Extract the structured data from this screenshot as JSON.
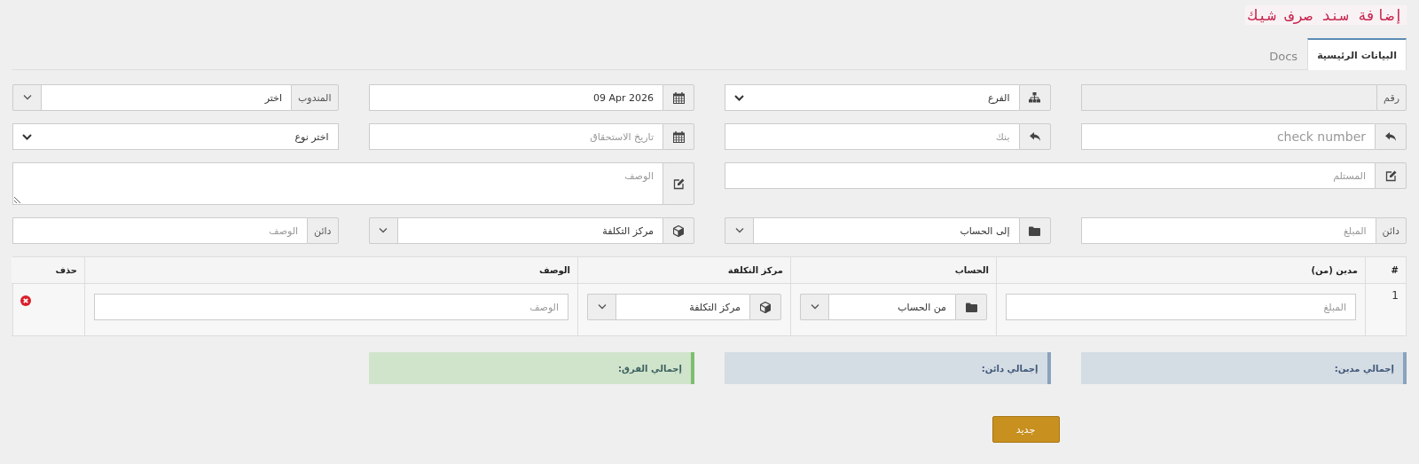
{
  "title": "إضافة سند صرف شيك",
  "tabs": [
    {
      "label": "البيانات الرئيسية",
      "selected": true
    },
    {
      "label": "Docs",
      "selected": false
    }
  ],
  "fields": [
    {
      "kind": "number",
      "label": "رقم",
      "disabled": true
    },
    {
      "kind": "branch",
      "value": "الفرع",
      "disabled": false
    },
    {
      "kind": "date",
      "value": "09 Apr 2026",
      "disabled": false
    },
    {
      "kind": "rep",
      "label": "المندوب",
      "value": "اختر",
      "disabled": false
    },
    {
      "kind": "check",
      "placeholder": "check number",
      "disabled": false
    },
    {
      "kind": "bank",
      "placeholder": "بنك",
      "disabled": false
    },
    {
      "kind": "due_date",
      "placeholder": "تاريخ الاستحقاق",
      "disabled": false
    },
    {
      "kind": "type",
      "value": "اختر نوع",
      "disabled": false
    },
    {
      "kind": "payee",
      "placeholder": "المستلم",
      "disabled": false
    },
    {
      "kind": "description",
      "placeholder": "الوصف",
      "disabled": false
    },
    {
      "kind": "credit",
      "label": "دائن",
      "placeholder": "المبلغ",
      "disabled": false
    },
    {
      "kind": "account",
      "value": "إلى الحساب",
      "disabled": false
    },
    {
      "kind": "cost_center",
      "value": "مركز التكلفة",
      "disabled": false
    },
    {
      "kind": "credit_memo",
      "label": "دائن",
      "placeholder": "الوصف",
      "disabled": false
    }
  ],
  "table": {
    "columns": [
      "#",
      "مدين (من)",
      "الحساب",
      "مركز التكلفة",
      "الوصف",
      "حذف"
    ],
    "rows": [
      {
        "cells": [
          {
            "kind": "index",
            "text": "1"
          },
          {
            "kind": "amount",
            "placeholder": "المبلغ"
          },
          {
            "kind": "account",
            "value": "من الحساب"
          },
          {
            "kind": "cost_center",
            "value": "مركز التكلفة"
          },
          {
            "kind": "memo",
            "placeholder": "الوصف"
          },
          {
            "kind": "delete"
          }
        ]
      }
    ]
  },
  "totals": [
    {
      "label": "إجمالي مدين:",
      "color": "#8aa3bd"
    },
    {
      "label": "إجمالي دائن:",
      "color": "#8aa3bd"
    },
    {
      "label": "إجمالي الفرق:",
      "color": "#7cbf6e"
    }
  ],
  "button": "جديد"
}
